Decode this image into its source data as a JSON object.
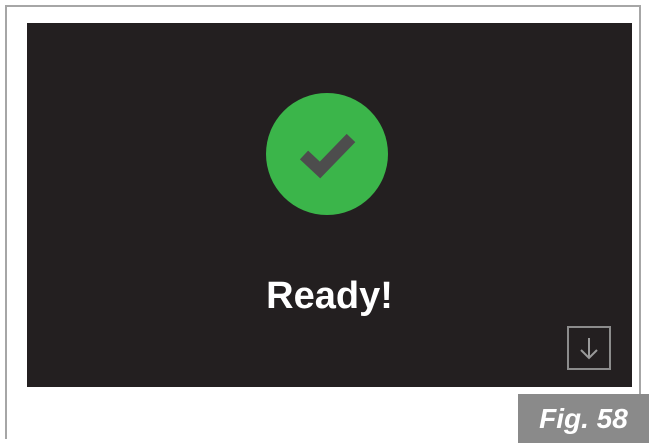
{
  "screen": {
    "status_text": "Ready!",
    "status_icon": "check-icon",
    "download_icon": "arrow-down-icon"
  },
  "figure": {
    "label": "Fig. 58"
  },
  "colors": {
    "screen_background": "#231f20",
    "success_green": "#3bb54a",
    "check_gray": "#4d4d4d",
    "label_background": "#8a8a8a",
    "frame_border": "#a6a6a6"
  }
}
